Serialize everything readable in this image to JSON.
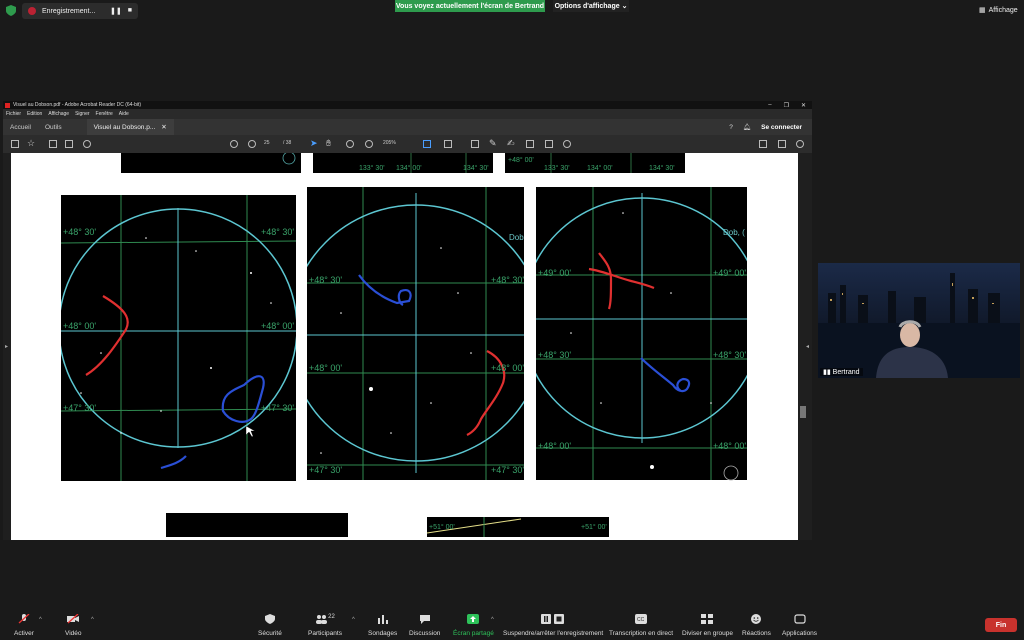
{
  "zoom": {
    "recording_label": "Enregistrement...",
    "share_banner": "Vous voyez actuellement l'écran de Bertrand",
    "view_options": "Options d'affichage",
    "affichage": "Affichage",
    "participant_name": "Bertrand",
    "participants_count": "22",
    "end_label": "Fin",
    "bottom": {
      "audio": "Activer",
      "video": "Vidéo",
      "security": "Sécurité",
      "participants": "Participants",
      "polls": "Sondages",
      "chat": "Discussion",
      "share": "Écran partagé",
      "record": "Suspendre/arrêter l'enregistrement",
      "transcript": "Transcription en direct",
      "breakout": "Diviser en groupe",
      "reactions": "Réactions",
      "apps": "Applications"
    }
  },
  "acrobat": {
    "window_title": "Visuel au Dobson.pdf - Adobe Acrobat Reader DC (64-bit)",
    "menu": [
      "Fichier",
      "Edition",
      "Affichage",
      "Signer",
      "Fenêtre",
      "Aide"
    ],
    "tabs": {
      "home": "Accueil",
      "tools": "Outils",
      "doc": "Visuel au Dobson.p..."
    },
    "signin": "Se connecter",
    "page_current": "25",
    "page_total": "/ 38",
    "zoom": "205%"
  },
  "charts": {
    "top_strip_labels": [
      "133° 30'",
      "134° 00'",
      "134° 30'",
      "133° 30'",
      "134° 00'",
      "134° 30'",
      "+48° 00'"
    ],
    "left": {
      "labels": [
        "+48° 30'",
        "+48° 30'",
        "+48° 00'",
        "+48° 00'",
        "+47° 30'",
        "+47° 30'"
      ]
    },
    "middle": {
      "labels": [
        "+48° 30'",
        "+48° 30'",
        "+48° 00'",
        "+48° 00'",
        "+47° 30'",
        "+47° 30'"
      ],
      "dob": "Dob"
    },
    "right": {
      "labels": [
        "+49° 00'",
        "+49° 00'",
        "+48° 30'",
        "+48° 30'",
        "+48° 00'",
        "+48° 00'"
      ],
      "dob": "Dob, ("
    },
    "bottom_labels": [
      "+51° 00'",
      "+51° 00'"
    ]
  }
}
